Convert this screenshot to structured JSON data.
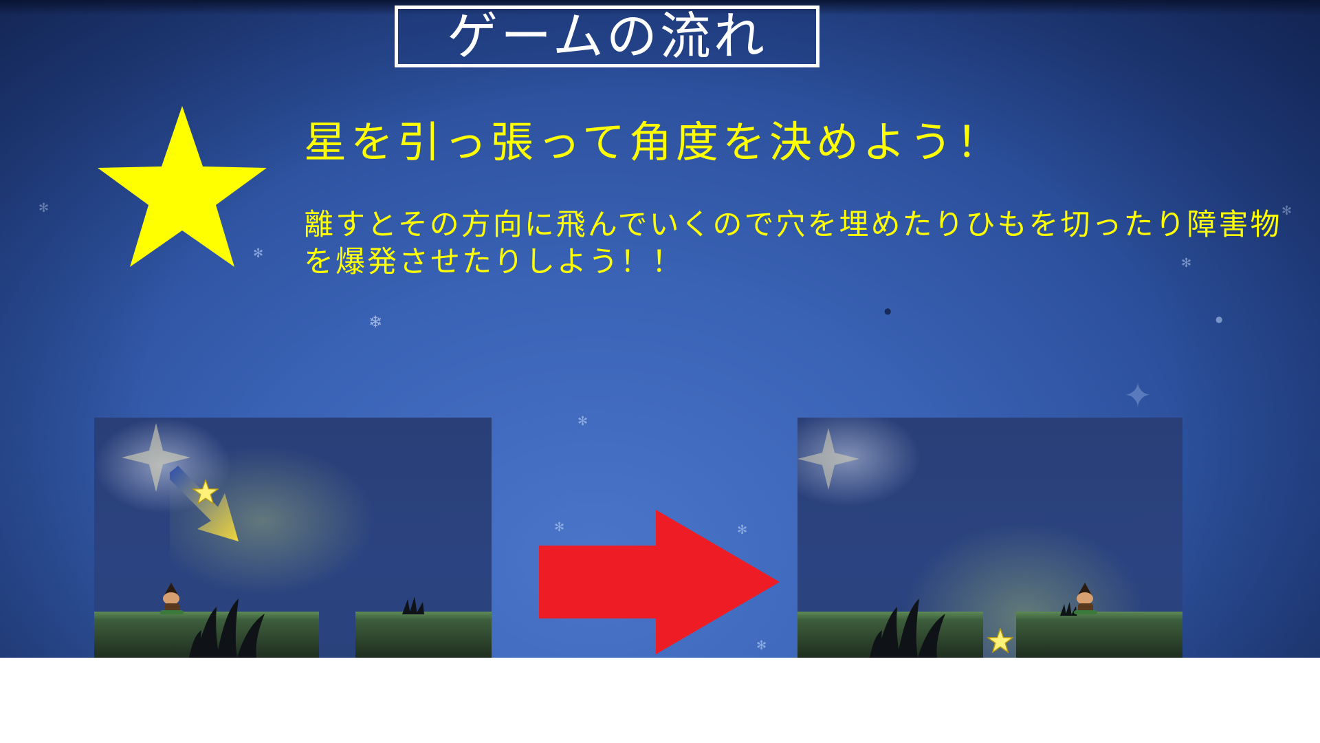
{
  "slide": {
    "title": "ゲームの流れ",
    "heading": "星を引っ張って角度を決めよう！",
    "description": "離すとその方向に飛んでいくので穴を埋めたりひもを切ったり障害物を爆発させたりしよう！！"
  },
  "colors": {
    "accent_yellow": "#ffff00",
    "arrow_red": "#ee1c24",
    "title_border": "#ffffff"
  },
  "icons": {
    "big_star": "star-icon",
    "arrow": "arrow-right-icon"
  }
}
